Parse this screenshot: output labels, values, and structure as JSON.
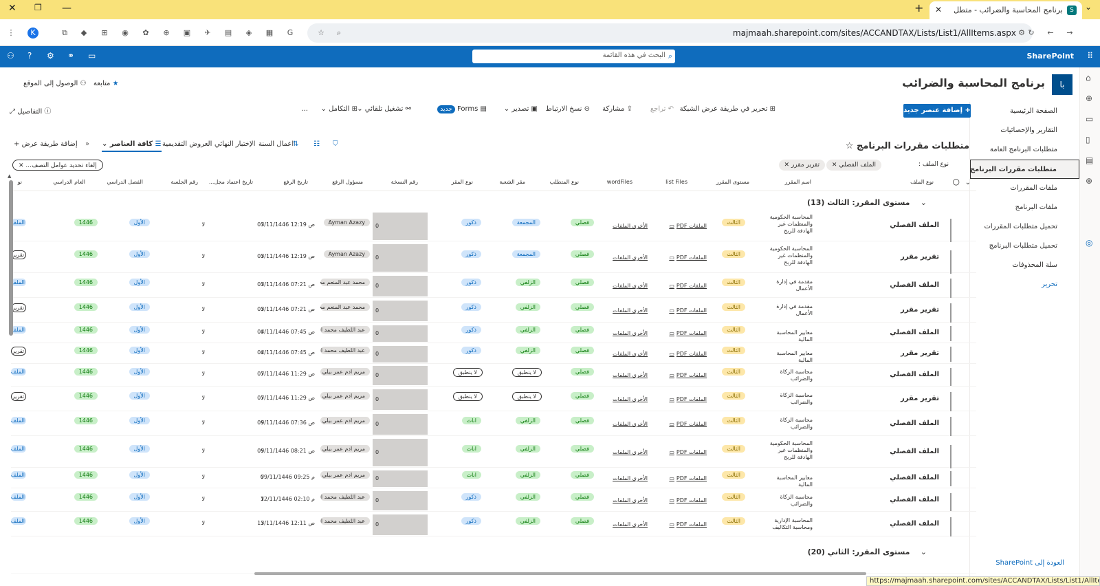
{
  "browser": {
    "tab_title": "برنامج المحاسبة والضرائب - متطل",
    "url": "majmaah.sharepoint.com/sites/ACCANDTAX/Lists/List1/AllItems.aspx",
    "status_url": "https://majmaah.sharepoint.com/sites/ACCANDTAX/Lists/List1/AllItems.aspx"
  },
  "suite": {
    "brand": "SharePoint",
    "search_placeholder": "البحث في هذه القائمة"
  },
  "site": {
    "logo_text": "با",
    "title": "برنامج المحاسبة والضرائب",
    "follow": "متابعة",
    "site_access": "الوصول إلى الموقع"
  },
  "nav": {
    "items": [
      "الصفحة الرئيسية",
      "التقارير والإحصائيات",
      "متطلبات البرنامج العامة",
      "متطلبات مقررات البرنامج",
      "ملفات المقررات",
      "ملفات البرنامج",
      "تحميل متطلبات المقررات",
      "تحميل متطلبات البرنامج",
      "سلة المحذوفات"
    ],
    "edit": "تحرير",
    "back": "العودة إلى SharePoint"
  },
  "commands": {
    "add_new": "إضافة عنصر جديد",
    "edit_grid": "تحرير في طريقة عرض الشبكة",
    "undo": "تراجع",
    "share": "مشاركة",
    "copy_link": "نسخ الارتباط",
    "export": "تصدير",
    "forms": "Forms",
    "new_badge": "جديد",
    "automate": "تشغيل تلقائي",
    "integrate": "التكامل",
    "more": "...",
    "details": "التفاصيل"
  },
  "list": {
    "title": "متطلبات مقررات البرنامج",
    "views": [
      "كافة العناصر",
      "العروض التقديمية",
      "الإختبار النهائي",
      "اعمال السنة"
    ],
    "add_view": "إضافة طريقة عرض"
  },
  "filters": {
    "label": "نوع الملف :",
    "pills": [
      "الملف الفصلي",
      "تقرير مقرر"
    ],
    "clear": "إلغاء تحديد عوامل التصف..."
  },
  "columns": [
    "نوع الملف",
    "اسم المقرر",
    "مستوى المقرر",
    "list Files",
    "wordFiles",
    "نوع المتطلب",
    "مقر الشعبة",
    "نوع المقر",
    "رقم النسخة",
    "مسؤول الرفع",
    "تاريخ الرفع",
    "تاريخ اعتماد مجل...",
    "رقم الجلسة",
    "الفصل الدراسي",
    "العام الدراسي",
    "نو"
  ],
  "groups": [
    {
      "label": "مستوى المقرر: الثالث (13)"
    },
    {
      "label": "مستوى المقرر: الثاني (20)"
    }
  ],
  "link_texts": {
    "pdf": "الملفات PDF",
    "other": "الأخرى الملفات"
  },
  "rows": [
    {
      "type": "الملف الفصلي",
      "course": "المحاسبة الحكومية والمنظمات غير الهادفة للربح",
      "level": "الثالث",
      "req": "فصلي",
      "campus": "المجمعة",
      "gender": "ذكور",
      "version": "0",
      "uploader": "Ayman Azazy",
      "date": "03/11/1446 12:19 ص",
      "approval": "لا",
      "session": "لا",
      "term": "الأول",
      "year": "1446",
      "last": "الملف"
    },
    {
      "type": "تقرير مقرر",
      "course": "المحاسبة الحكومية والمنظمات غير الهادفة للربح",
      "level": "الثالث",
      "req": "فصلي",
      "campus": "المجمعة",
      "gender": "ذكور",
      "version": "0",
      "uploader": "Ayman Azazy",
      "date": "03/11/1446 12:19 ص",
      "approval": "لا",
      "session": "لا",
      "term": "الأول",
      "year": "1446",
      "last": "تقرير"
    },
    {
      "type": "الملف الفصلي",
      "course": "مقدمة في إدارة الأعمال",
      "level": "الثالث",
      "req": "فصلي",
      "campus": "الزلفي",
      "gender": "ذكور",
      "version": "0",
      "uploader": "محمد عبد المنعم محمد",
      "date": "03/11/1446 07:21 ص",
      "approval": "لا",
      "session": "لا",
      "term": "الأول",
      "year": "1446",
      "last": "الملف"
    },
    {
      "type": "تقرير مقرر",
      "course": "مقدمة في إدارة الأعمال",
      "level": "الثالث",
      "req": "فصلي",
      "campus": "الزلفي",
      "gender": "ذكور",
      "version": "0",
      "uploader": "محمد عبد المنعم محمد",
      "date": "03/11/1446 07:21 ص",
      "approval": "لا",
      "session": "لا",
      "term": "الأول",
      "year": "1446",
      "last": "تقرير"
    },
    {
      "type": "الملف الفصلي",
      "course": "معايير المحاسبة المالية",
      "level": "الثالث",
      "req": "فصلي",
      "campus": "الزلفي",
      "gender": "ذكور",
      "version": "0",
      "uploader": "عبد اللطيف محمد الحسـ",
      "date": "04/11/1446 07:45 ص",
      "approval": "لا",
      "session": "لا",
      "term": "الأول",
      "year": "1446",
      "last": "الملف"
    },
    {
      "type": "تقرير مقرر",
      "course": "معايير المحاسبة المالية",
      "level": "الثالث",
      "req": "فصلي",
      "campus": "الزلفي",
      "gender": "ذكور",
      "version": "0",
      "uploader": "عبد اللطيف محمد الحسـ",
      "date": "04/11/1446 07:45 ص",
      "approval": "لا",
      "session": "لا",
      "term": "الأول",
      "year": "1446",
      "last": "تقرير"
    },
    {
      "type": "الملف الفصلي",
      "course": "محاسبة الزكاة والضرائب",
      "level": "الثالث",
      "req": "فصلي",
      "campus": "لا ينطبق",
      "gender": "لا ينطبق",
      "version": "0",
      "uploader": "مريم ادم عمر بيلي",
      "date": "07/11/1446 11:29 ص",
      "approval": "لا",
      "session": "لا",
      "term": "الأول",
      "year": "1446",
      "last": "الملف"
    },
    {
      "type": "تقرير مقرر",
      "course": "محاسبة الزكاة والضرائب",
      "level": "الثالث",
      "req": "فصلي",
      "campus": "لا ينطبق",
      "gender": "لا ينطبق",
      "version": "0",
      "uploader": "مريم ادم عمر بيلي",
      "date": "07/11/1446 11:29 ص",
      "approval": "لا",
      "session": "لا",
      "term": "الأول",
      "year": "1446",
      "last": "تقرير"
    },
    {
      "type": "الملف الفصلي",
      "course": "محاسبة الزكاة والضرائب",
      "level": "الثالث",
      "req": "فصلي",
      "campus": "الزلفي",
      "gender": "اناث",
      "version": "0",
      "uploader": "مريم ادم عمر بيلي",
      "date": "09/11/1446 07:36 ص",
      "approval": "لا",
      "session": "لا",
      "term": "الأول",
      "year": "1446",
      "last": "الملف"
    },
    {
      "type": "الملف الفصلي",
      "course": "المحاسبة الحكومية والمنظمات غير الهادفة للربح",
      "level": "الثالث",
      "req": "فصلي",
      "campus": "الزلفي",
      "gender": "اناث",
      "version": "0",
      "uploader": "مريم ادم عمر بيلي",
      "date": "09/11/1446 08:21 ص",
      "approval": "لا",
      "session": "لا",
      "term": "الأول",
      "year": "1446",
      "last": "الملف"
    },
    {
      "type": "الملف الفصلي",
      "course": "معايير المحاسبة المالية",
      "level": "الثالث",
      "req": "فصلي",
      "campus": "الزلفي",
      "gender": "اناث",
      "version": "0",
      "uploader": "مريم ادم عمر بيلي",
      "date": "09/11/1446 09:25 م",
      "approval": "لا",
      "session": "لا",
      "term": "الأول",
      "year": "1446",
      "last": "الملف"
    },
    {
      "type": "الملف الفصلي",
      "course": "محاسبة الزكاة والضرائب",
      "level": "الثالث",
      "req": "فصلي",
      "campus": "الزلفي",
      "gender": "ذكور",
      "version": "0",
      "uploader": "عبد اللطيف محمد الحسـ",
      "date": "12/11/1446 02:10 م",
      "approval": "لا",
      "session": "لا",
      "term": "الأول",
      "year": "1446",
      "last": "الملف"
    },
    {
      "type": "الملف الفصلي",
      "course": "المحاسبة الإدارية ومحاسبة التكاليف",
      "level": "الثالث",
      "req": "فصلي",
      "campus": "الزلفي",
      "gender": "ذكور",
      "version": "0",
      "uploader": "عبد اللطيف محمد الحسـ",
      "date": "13/11/1446 12:11 ص",
      "approval": "لا",
      "session": "لا",
      "term": "الأول",
      "year": "1446",
      "last": "الملف"
    }
  ]
}
